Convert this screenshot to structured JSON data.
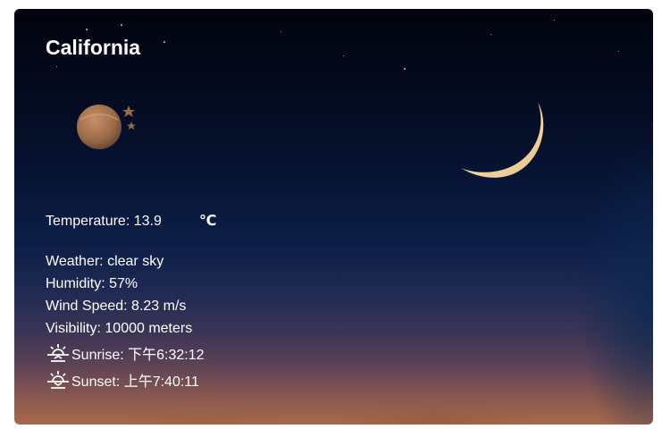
{
  "city": "California",
  "temperature": {
    "label": "Temperature: 13.9",
    "unit": "℃"
  },
  "details": {
    "weather": "Weather: clear sky",
    "humidity": "Humidity: 57%",
    "wind_speed": "Wind Speed: 8.23 m/s",
    "visibility": "Visibility: 10000 meters"
  },
  "sun": {
    "sunrise": "Sunrise: 下午6:32:12",
    "sunset": "Sunset: 上午7:40:11"
  },
  "icons": {
    "weather": "moon-stars-icon",
    "sunrise": "sunrise-icon",
    "sunset": "sunset-icon"
  },
  "colors": {
    "text": "#ffffff",
    "sky_top": "#02040f",
    "sky_bottom": "#a8694d",
    "moon": "#f4d9a6"
  }
}
